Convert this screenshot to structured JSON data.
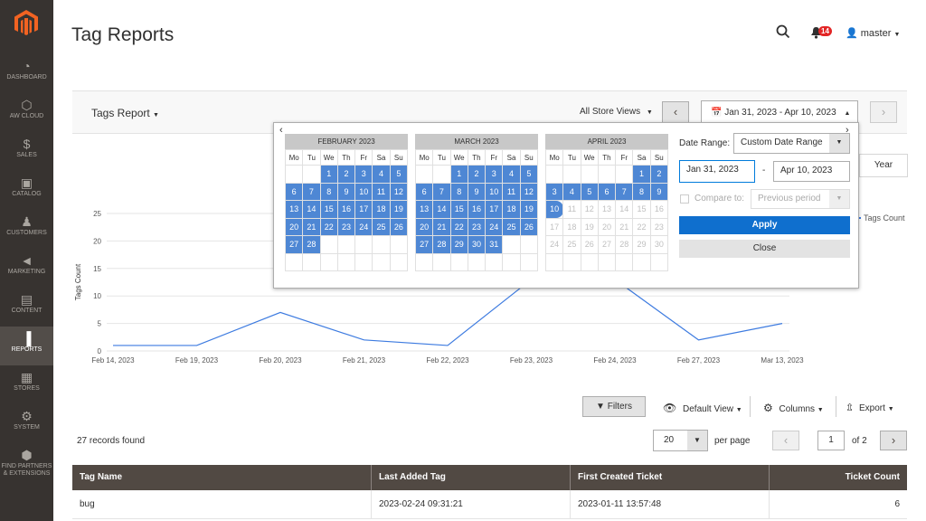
{
  "sidebar": {
    "items": [
      {
        "label": "DASHBOARD",
        "icon": "speedometer-icon"
      },
      {
        "label": "AW CLOUD",
        "icon": "hexagon-icon"
      },
      {
        "label": "SALES",
        "icon": "dollar-icon"
      },
      {
        "label": "CATALOG",
        "icon": "box-icon"
      },
      {
        "label": "CUSTOMERS",
        "icon": "person-icon"
      },
      {
        "label": "MARKETING",
        "icon": "megaphone-icon"
      },
      {
        "label": "CONTENT",
        "icon": "layout-icon"
      },
      {
        "label": "REPORTS",
        "icon": "bar-chart-icon"
      },
      {
        "label": "STORES",
        "icon": "store-icon"
      },
      {
        "label": "SYSTEM",
        "icon": "gear-icon"
      },
      {
        "label": "FIND PARTNERS & EXTENSIONS",
        "icon": "cube-icon"
      }
    ],
    "active": "REPORTS"
  },
  "header": {
    "title": "Tag Reports",
    "notification_count": "14",
    "user": "master"
  },
  "toolbar": {
    "report_select": "Tags Report",
    "store_views": "All Store Views",
    "date_range": "Jan 31, 2023 - Apr 10, 2023",
    "year_button": "Year",
    "legend": "Tags Count"
  },
  "chart_data": {
    "type": "line",
    "ylabel": "Tags Count",
    "xlabel": "",
    "categories": [
      "Feb 14, 2023",
      "Feb 19, 2023",
      "Feb 20, 2023",
      "Feb 21, 2023",
      "Feb 22, 2023",
      "Feb 23, 2023",
      "Feb 24, 2023",
      "Feb 27, 2023",
      "Mar 13, 2023"
    ],
    "series": [
      {
        "name": "Tags Count",
        "values": [
          1,
          1,
          7,
          2,
          1,
          13,
          13,
          2,
          5
        ]
      }
    ],
    "yticks": [
      0,
      5,
      10,
      15,
      20,
      25
    ],
    "ylim": [
      0,
      25
    ],
    "color": "#3d7be0"
  },
  "datepicker": {
    "months": [
      {
        "name": "FEBRUARY 2023",
        "offset": 2,
        "days": 28,
        "selected_from": 1,
        "selected_to": 28,
        "disabled_from": 99
      },
      {
        "name": "MARCH 2023",
        "offset": 2,
        "days": 31,
        "selected_from": 1,
        "selected_to": 31,
        "disabled_from": 99
      },
      {
        "name": "APRIL 2023",
        "offset": 5,
        "days": 30,
        "selected_from": 1,
        "selected_to": 10,
        "disabled_from": 11
      }
    ],
    "weekdays": [
      "Mo",
      "Tu",
      "We",
      "Th",
      "Fr",
      "Sa",
      "Su"
    ],
    "date_range_label": "Date Range:",
    "date_range_value": "Custom Date Range",
    "from": "Jan 31, 2023",
    "separator": "-",
    "to": "Apr 10, 2023",
    "compare_label": "Compare to:",
    "compare_value": "Previous period",
    "apply": "Apply",
    "close": "Close"
  },
  "grid": {
    "filters": "Filters",
    "view": "Default View",
    "columns": "Columns",
    "export": "Export",
    "records": "27 records found",
    "per_page": "20",
    "per_page_label": "per page",
    "page": "1",
    "of_pages": "of 2",
    "headers": [
      "Tag Name",
      "Last Added Tag",
      "First Created Ticket",
      "Ticket Count"
    ],
    "rows": [
      [
        "bug",
        "2023-02-24 09:31:21",
        "2023-01-11 13:57:48",
        "6"
      ]
    ]
  }
}
